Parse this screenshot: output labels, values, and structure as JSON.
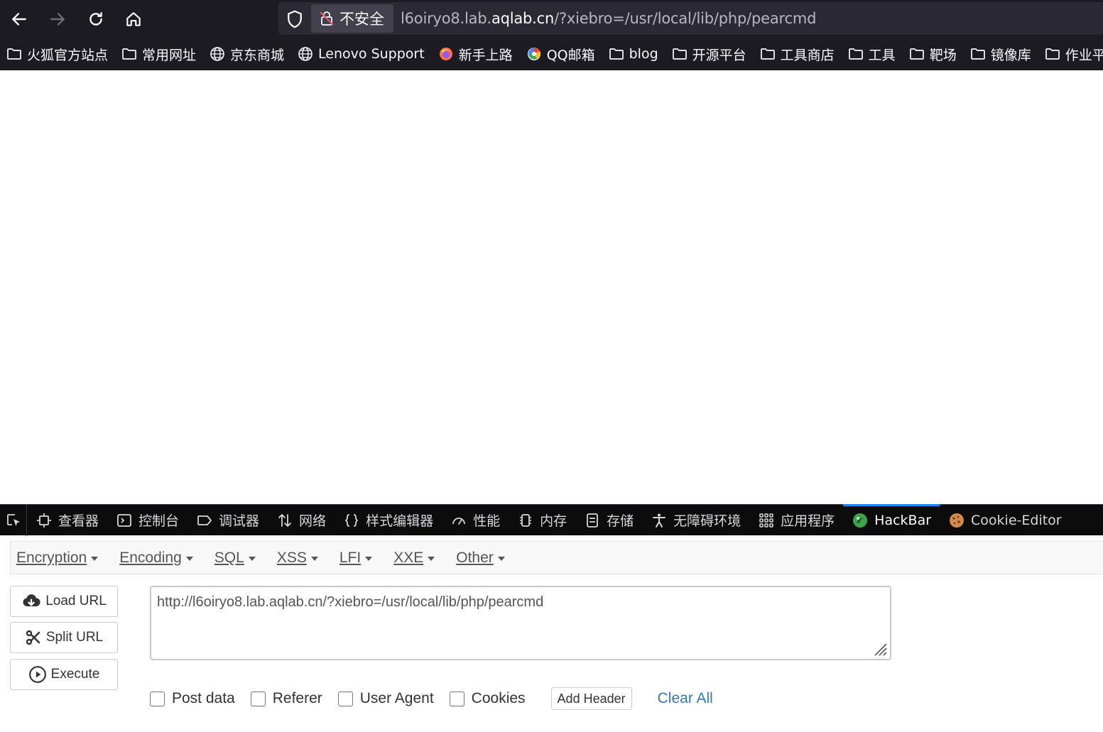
{
  "browser": {
    "insecure_label": "不安全",
    "url_prefix": "l6oiryo8.lab.",
    "url_domain": "aqlab.cn",
    "url_suffix": "/?xiebro=/usr/local/lib/php/pearcmd"
  },
  "bookmarks": [
    {
      "label": "火狐官方站点",
      "icon": "folder-icon"
    },
    {
      "label": "常用网址",
      "icon": "folder-icon"
    },
    {
      "label": "京东商城",
      "icon": "globe-icon"
    },
    {
      "label": "Lenovo Support",
      "icon": "globe-icon"
    },
    {
      "label": "新手上路",
      "icon": "firefox-icon"
    },
    {
      "label": "QQ邮箱",
      "icon": "qq-mail-icon"
    },
    {
      "label": "blog",
      "icon": "folder-icon"
    },
    {
      "label": "开源平台",
      "icon": "folder-icon"
    },
    {
      "label": "工具商店",
      "icon": "folder-icon"
    },
    {
      "label": "工具",
      "icon": "folder-icon"
    },
    {
      "label": "靶场",
      "icon": "folder-icon"
    },
    {
      "label": "镜像库",
      "icon": "folder-icon"
    },
    {
      "label": "作业平台",
      "icon": "folder-icon"
    }
  ],
  "devtools": {
    "tabs": [
      {
        "label": "查看器",
        "icon": "inspector-icon"
      },
      {
        "label": "控制台",
        "icon": "console-icon"
      },
      {
        "label": "调试器",
        "icon": "debugger-icon"
      },
      {
        "label": "网络",
        "icon": "network-icon"
      },
      {
        "label": "样式编辑器",
        "icon": "style-editor-icon"
      },
      {
        "label": "性能",
        "icon": "performance-icon"
      },
      {
        "label": "内存",
        "icon": "memory-icon"
      },
      {
        "label": "存储",
        "icon": "storage-icon"
      },
      {
        "label": "无障碍环境",
        "icon": "accessibility-icon"
      },
      {
        "label": "应用程序",
        "icon": "application-icon"
      },
      {
        "label": "HackBar",
        "icon": "hackbar-icon",
        "active": true
      },
      {
        "label": "Cookie-Editor",
        "icon": "cookie-icon"
      }
    ]
  },
  "hackbar": {
    "menu": [
      "Encryption",
      "Encoding",
      "SQL",
      "XSS",
      "LFI",
      "XXE",
      "Other"
    ],
    "load_url": "Load URL",
    "split_url": "Split URL",
    "execute": "Execute",
    "url_value": "http://l6oiryo8.lab.aqlab.cn/?xiebro=/usr/local/lib/php/pearcmd",
    "options": [
      "Post data",
      "Referer",
      "User Agent",
      "Cookies"
    ],
    "add_header": "Add Header",
    "clear_all": "Clear All"
  },
  "colors": {
    "chrome_bg": "#1c1b22",
    "urlbar_bg": "#2b2a33",
    "devtools_bg": "#0c0c0d",
    "active_tab_accent": "#1a89f5",
    "link_blue": "#337ab7"
  }
}
